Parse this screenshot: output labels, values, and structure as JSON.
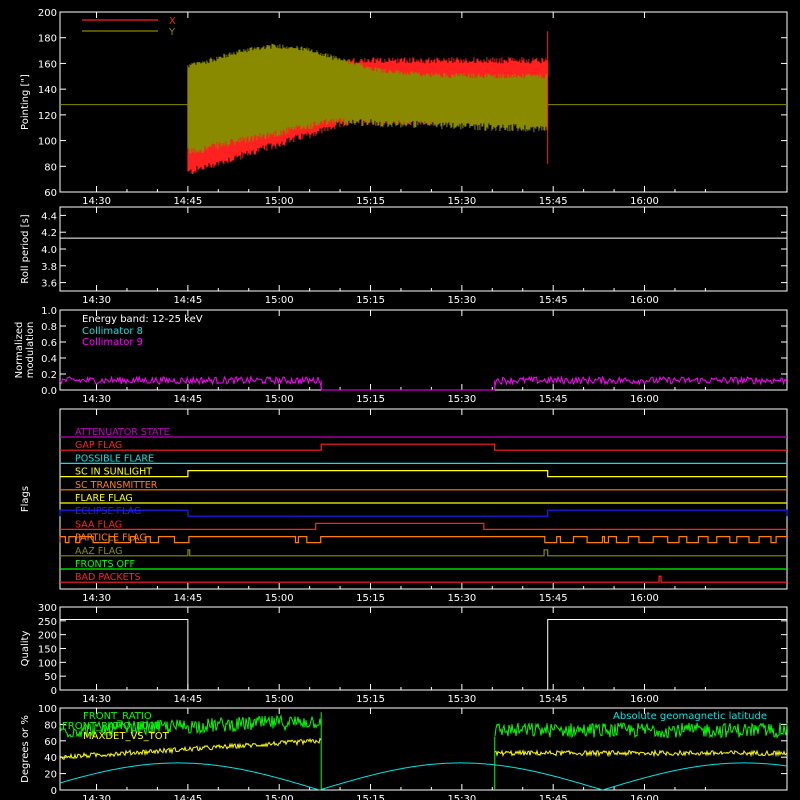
{
  "colors": {
    "background": "#000000",
    "axis": "#ffffff",
    "x": "#ff2020",
    "y": "#8a8a00",
    "cyan": "#00e5e5",
    "magenta": "#ff00ff",
    "green": "#00ff00",
    "yellow": "#ffff00",
    "orange": "#ff8000",
    "blue": "#2020ff",
    "purple": "#c000c0",
    "red": "#ff2020"
  },
  "time_axis": {
    "ticks": [
      "14:30",
      "14:45",
      "15:00",
      "15:15",
      "15:30",
      "15:45",
      "16:00"
    ],
    "range_minutes": [
      14.9,
      16.39
    ],
    "tick_hours": [
      14.5,
      14.75,
      15.0,
      15.25,
      15.5,
      15.75,
      16.0
    ]
  },
  "chart_data": [
    {
      "type": "line",
      "ylabel": "Pointing [\"]",
      "ylim": [
        60,
        200
      ],
      "yticks": [
        "60",
        "80",
        "100",
        "120",
        "140",
        "160",
        "180",
        "200"
      ],
      "series": [
        {
          "name": "X",
          "color_key": "x"
        },
        {
          "name": "Y",
          "color_key": "y"
        }
      ],
      "flat_value": 128,
      "active_range": [
        14.75,
        15.735
      ]
    },
    {
      "type": "line",
      "ylabel": "Roll period [s]",
      "ylim": [
        3.5,
        4.5
      ],
      "yticks": [
        "3.6",
        "3.8",
        "4.0",
        "4.2",
        "4.4"
      ],
      "value": 4.13
    },
    {
      "type": "line",
      "ylabel": "Normalized modulation",
      "ylim": [
        0,
        1
      ],
      "yticks": [
        "0.0",
        "0.2",
        "0.4",
        "0.6",
        "0.8",
        "1.0"
      ],
      "annotation": "Energy band: 12-25 keV",
      "series": [
        {
          "name": "Collimator 8",
          "color_key": "cyan"
        },
        {
          "name": "Collimator 9",
          "color_key": "magenta"
        }
      ],
      "gap": [
        15.115,
        15.59
      ],
      "level": 0.12
    },
    {
      "type": "line",
      "ylabel": "Flags",
      "flags": [
        {
          "name": "ATTENUATOR STATE",
          "color_key": "purple"
        },
        {
          "name": "GAP FLAG",
          "color_key": "red"
        },
        {
          "name": "POSSIBLE FLARE",
          "color_key": "cyan"
        },
        {
          "name": "SC IN SUNLIGHT",
          "color_key": "yellow"
        },
        {
          "name": "SC TRANSMITTER",
          "color_key": "orange"
        },
        {
          "name": "FLARE FLAG",
          "color_key": "yellow"
        },
        {
          "name": "ECLIPSE FLAG",
          "color_key": "blue"
        },
        {
          "name": "SAA FLAG",
          "color_key": "red"
        },
        {
          "name": "PARTICLE FLAG",
          "color_key": "orange"
        },
        {
          "name": "AAZ FLAG",
          "color_key": "y"
        },
        {
          "name": "FRONTS OFF",
          "color_key": "green"
        },
        {
          "name": "BAD PACKETS",
          "color_key": "red"
        }
      ]
    },
    {
      "type": "line",
      "ylabel": "Quality",
      "ylim": [
        0,
        300
      ],
      "yticks": [
        "0",
        "50",
        "100",
        "150",
        "200",
        "250",
        "300"
      ],
      "value": 255,
      "zero_range": [
        14.75,
        15.735
      ]
    },
    {
      "type": "line",
      "ylabel": "Degrees or %",
      "ylim": [
        0,
        100
      ],
      "yticks": [
        "0",
        "20",
        "40",
        "60",
        "80",
        "100"
      ],
      "series": [
        {
          "name": "FRONT_RATIO",
          "color_key": "green"
        },
        {
          "name": "FRONT_RATIO_1000",
          "color_key": "green"
        },
        {
          "name": "MAXDET_VS_TOT",
          "color_key": "yellow"
        },
        {
          "name": "Absolute geomagnetic latitude",
          "color_key": "cyan"
        }
      ],
      "gap": [
        15.115,
        15.59
      ]
    }
  ]
}
